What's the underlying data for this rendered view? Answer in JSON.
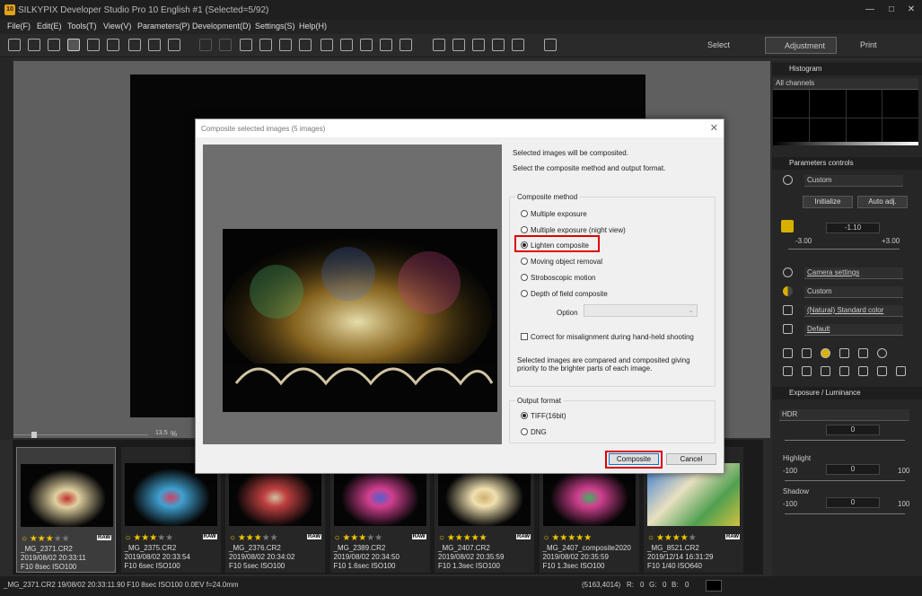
{
  "app": {
    "title": "SILKYPIX Developer Studio Pro 10 English  #1  (Selected=5/92)",
    "icon_text": "10",
    "window_controls": {
      "minimize": "—",
      "maximize": "□",
      "close": "✕"
    }
  },
  "menu": [
    "File(F)",
    "Edit(E)",
    "Tools(T)",
    "View(V)",
    "Parameters(P)",
    "Development(D)",
    "Settings(S)",
    "Help(H)"
  ],
  "modes": {
    "select": "Select",
    "adjustment": "Adjustment",
    "print": "Print"
  },
  "zoom": {
    "value": "13.5",
    "unit": "%"
  },
  "right_panel": {
    "histogram": {
      "title": "Histogram",
      "channel": "All channels"
    },
    "parameters": {
      "title": "Parameters controls",
      "preset": "Custom",
      "initialize": "Initialize",
      "auto_adj": "Auto adj.",
      "exposure_value": "-1.10",
      "exposure_min": "-3.00",
      "exposure_max": "+3.00",
      "camera_settings": "Camera settings",
      "wb": "Custom",
      "color": "(Natural) Standard color",
      "tone": "Default"
    },
    "exposure": {
      "title": "Exposure / Luminance",
      "mode": "HDR",
      "hdr_value": "0",
      "highlight_label": "Highlight",
      "highlight_value": "0",
      "highlight_min": "-100",
      "highlight_max": "100",
      "shadow_label": "Shadow",
      "shadow_value": "0",
      "shadow_min": "-100",
      "shadow_max": "100"
    }
  },
  "thumbnails": [
    {
      "name": "_MG_2371.CR2",
      "date": "2019/08/02 20:33:11",
      "info": "F10 8sec ISO100",
      "stars": 3,
      "raw": "RAW",
      "selected": true
    },
    {
      "name": "_MG_2375.CR2",
      "date": "2019/08/02 20:33:54",
      "info": "F10 6sec ISO100",
      "stars": 3,
      "raw": "RAW",
      "selected": false
    },
    {
      "name": "_MG_2376.CR2",
      "date": "2019/08/02 20:34:02",
      "info": "F10 5sec ISO100",
      "stars": 3,
      "raw": "RAW",
      "selected": false
    },
    {
      "name": "_MG_2389.CR2",
      "date": "2019/08/02 20:34:50",
      "info": "F10 1.6sec ISO100",
      "stars": 3,
      "raw": "RAW",
      "selected": false
    },
    {
      "name": "_MG_2407.CR2",
      "date": "2019/08/02 20:35:59",
      "info": "F10 1.3sec ISO100",
      "stars": 5,
      "raw": "RAW",
      "selected": false
    },
    {
      "name": "_MG_2407_composite2020",
      "date": "2019/08/02 20:35:59",
      "info": "F10 1.3sec ISO100",
      "stars": 5,
      "raw": "",
      "selected": false
    },
    {
      "name": "_MG_8521.CR2",
      "date": "2019/12/14 16:31:29",
      "info": "F10 1/40 ISO640",
      "stars": 4,
      "raw": "RAW",
      "selected": false
    }
  ],
  "status": {
    "file": "_MG_2371.CR2 19/08/02 20:33:11.90 F10 8sec ISO100  0.0EV f=24.0mm",
    "coords": "(5163,4014)",
    "r_label": "R:",
    "r_value": "0",
    "g_label": "G:",
    "g_value": "0",
    "b_label": "B:",
    "b_value": "0"
  },
  "dialog": {
    "title": "Composite selected images (5 images)",
    "intro1": "Selected images will be composited.",
    "intro2": "Select the composite method and output format.",
    "method_group": "Composite method",
    "methods": [
      "Multiple exposure",
      "Multiple exposure (night view)",
      "Lighten composite",
      "Moving object removal",
      "Stroboscopic motion",
      "Depth of field composite"
    ],
    "selected_method": "Lighten composite",
    "option_label": "Option",
    "misalign": "Correct for misalignment during hand-held shooting",
    "description": "Selected images are compared and composited giving priority to the brighter parts of each image.",
    "output_group": "Output format",
    "outputs": [
      "TIFF(16bit)",
      "DNG"
    ],
    "selected_output": "TIFF(16bit)",
    "composite_button": "Composite",
    "cancel_button": "Cancel"
  }
}
